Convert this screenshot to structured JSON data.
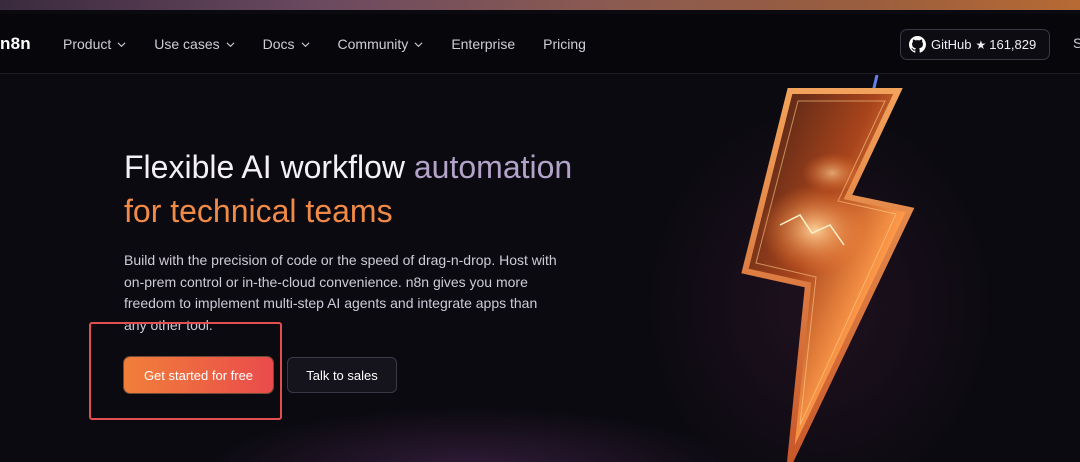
{
  "brand": {
    "logo": "n8n"
  },
  "nav": {
    "items": [
      {
        "label": "Product",
        "has_dropdown": true
      },
      {
        "label": "Use cases",
        "has_dropdown": true
      },
      {
        "label": "Docs",
        "has_dropdown": true
      },
      {
        "label": "Community",
        "has_dropdown": true
      },
      {
        "label": "Enterprise",
        "has_dropdown": false
      },
      {
        "label": "Pricing",
        "has_dropdown": false
      }
    ],
    "github": {
      "label": "GitHub",
      "star": "★",
      "count": "161,829",
      "icon": "github-icon"
    },
    "cut_off": "S"
  },
  "hero": {
    "title_white": "Flexible AI workflow",
    "title_purple": "automation",
    "title_orange": "for technical teams",
    "description_lines": [
      "Build with the precision of code or the speed of drag-n-drop. Host with",
      "on-prem control or in-the-cloud convenience. n8n gives you more",
      "freedom to implement multi-step AI agents and integrate apps than",
      "any other tool."
    ],
    "cta_primary": "Get started for free",
    "cta_secondary": "Talk to sales"
  },
  "colors": {
    "accent_orange": "#f08a46",
    "title_purple": "#b3a3c9",
    "highlight_red": "#e24f4f",
    "background": "#0b0a10"
  }
}
